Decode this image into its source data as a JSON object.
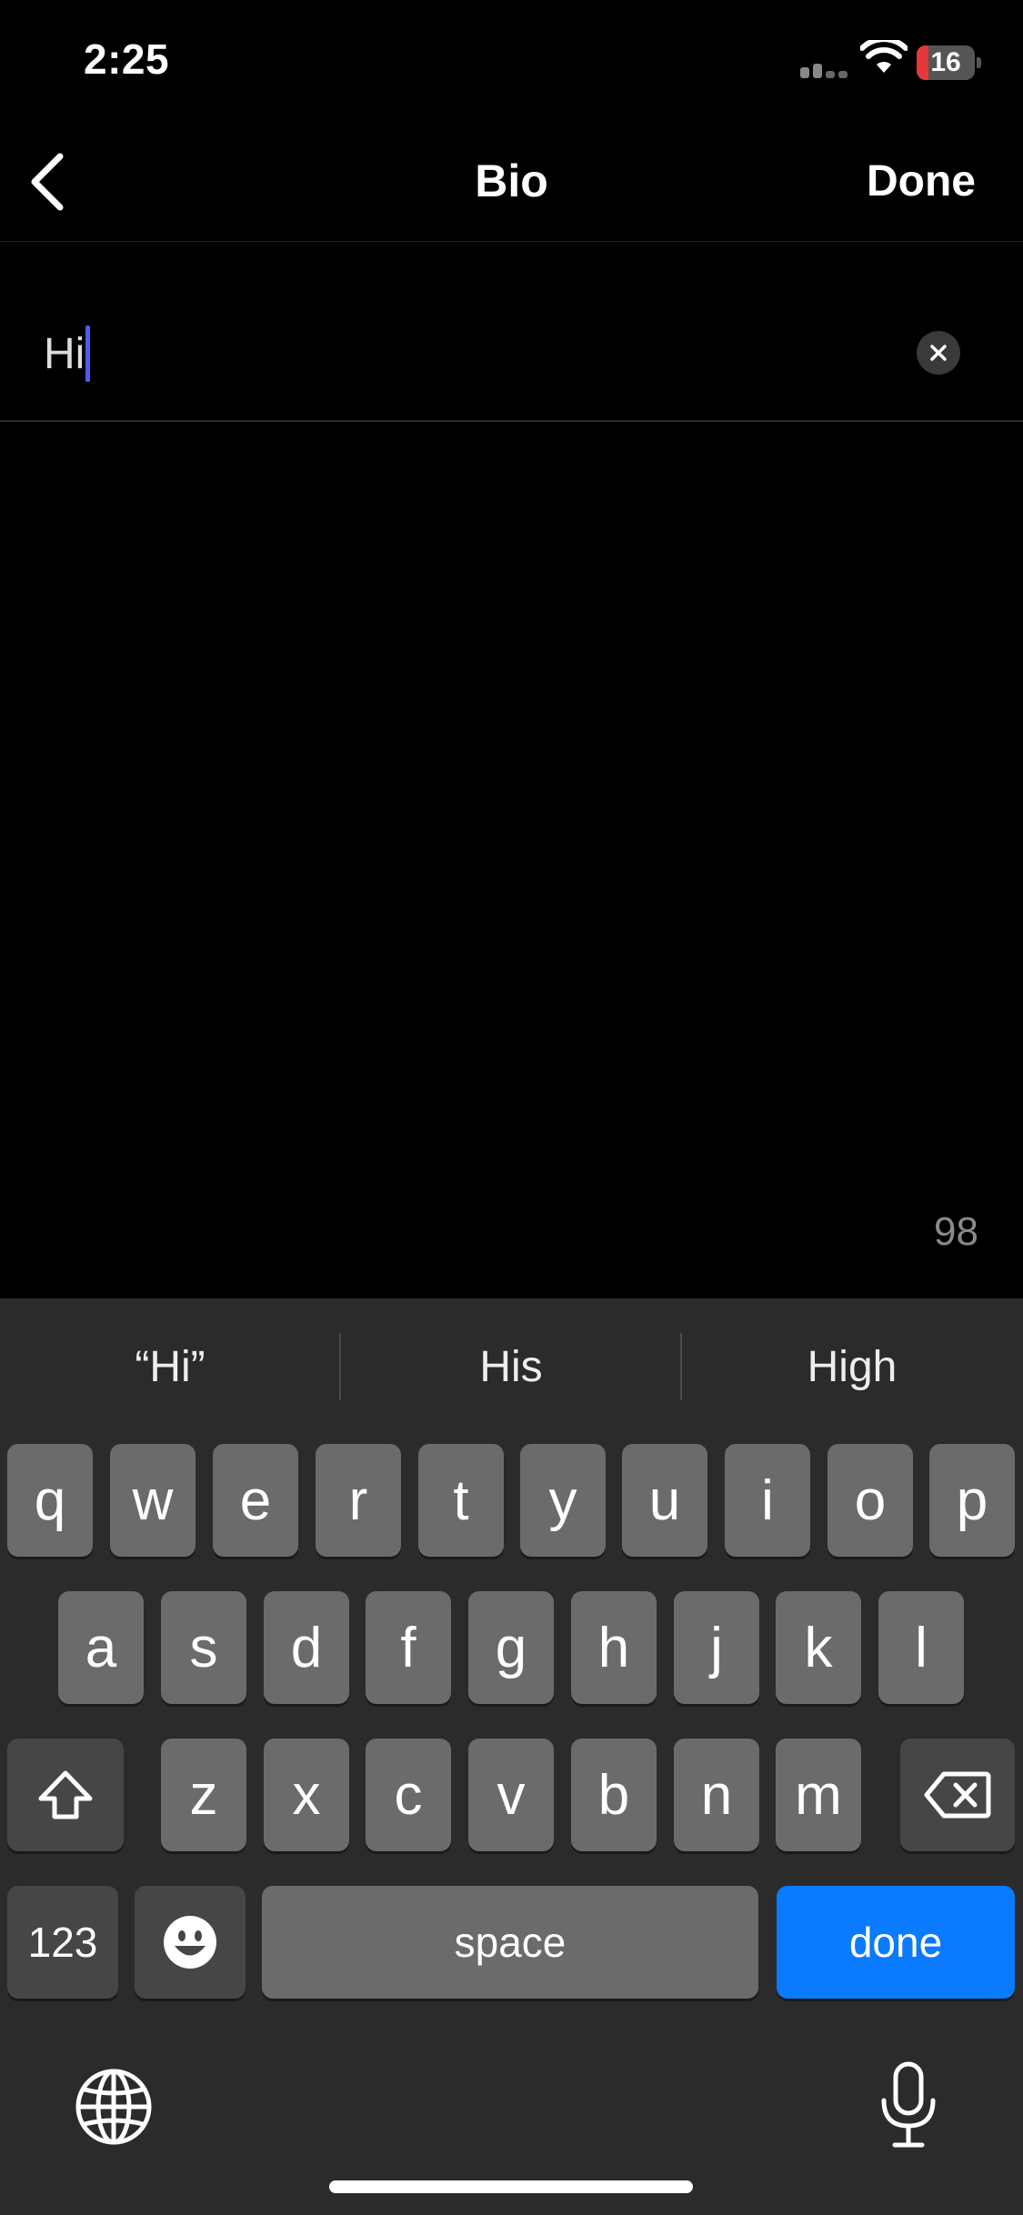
{
  "status_bar": {
    "time": "2:25",
    "battery_level": "16",
    "battery_fraction": 0.16,
    "battery_color": "#e5383b"
  },
  "nav": {
    "title": "Bio",
    "done_label": "Done",
    "back_icon": "chevron-left-icon"
  },
  "bio": {
    "value": "Hi",
    "cursor_color": "#4a5cf5",
    "clear_icon": "close-circle-icon"
  },
  "char_remaining": "98",
  "keyboard": {
    "suggestions": [
      "“Hi”",
      "His",
      "High"
    ],
    "row1": [
      "q",
      "w",
      "e",
      "r",
      "t",
      "y",
      "u",
      "i",
      "o",
      "p"
    ],
    "row2": [
      "a",
      "s",
      "d",
      "f",
      "g",
      "h",
      "j",
      "k",
      "l"
    ],
    "row3": [
      "z",
      "x",
      "c",
      "v",
      "b",
      "n",
      "m"
    ],
    "numbers_label": "123",
    "space_label": "space",
    "done_label": "done",
    "done_color": "#0a7aff",
    "icons": [
      "shift-icon",
      "delete-icon",
      "emoji-icon",
      "globe-icon",
      "microphone-icon"
    ]
  }
}
